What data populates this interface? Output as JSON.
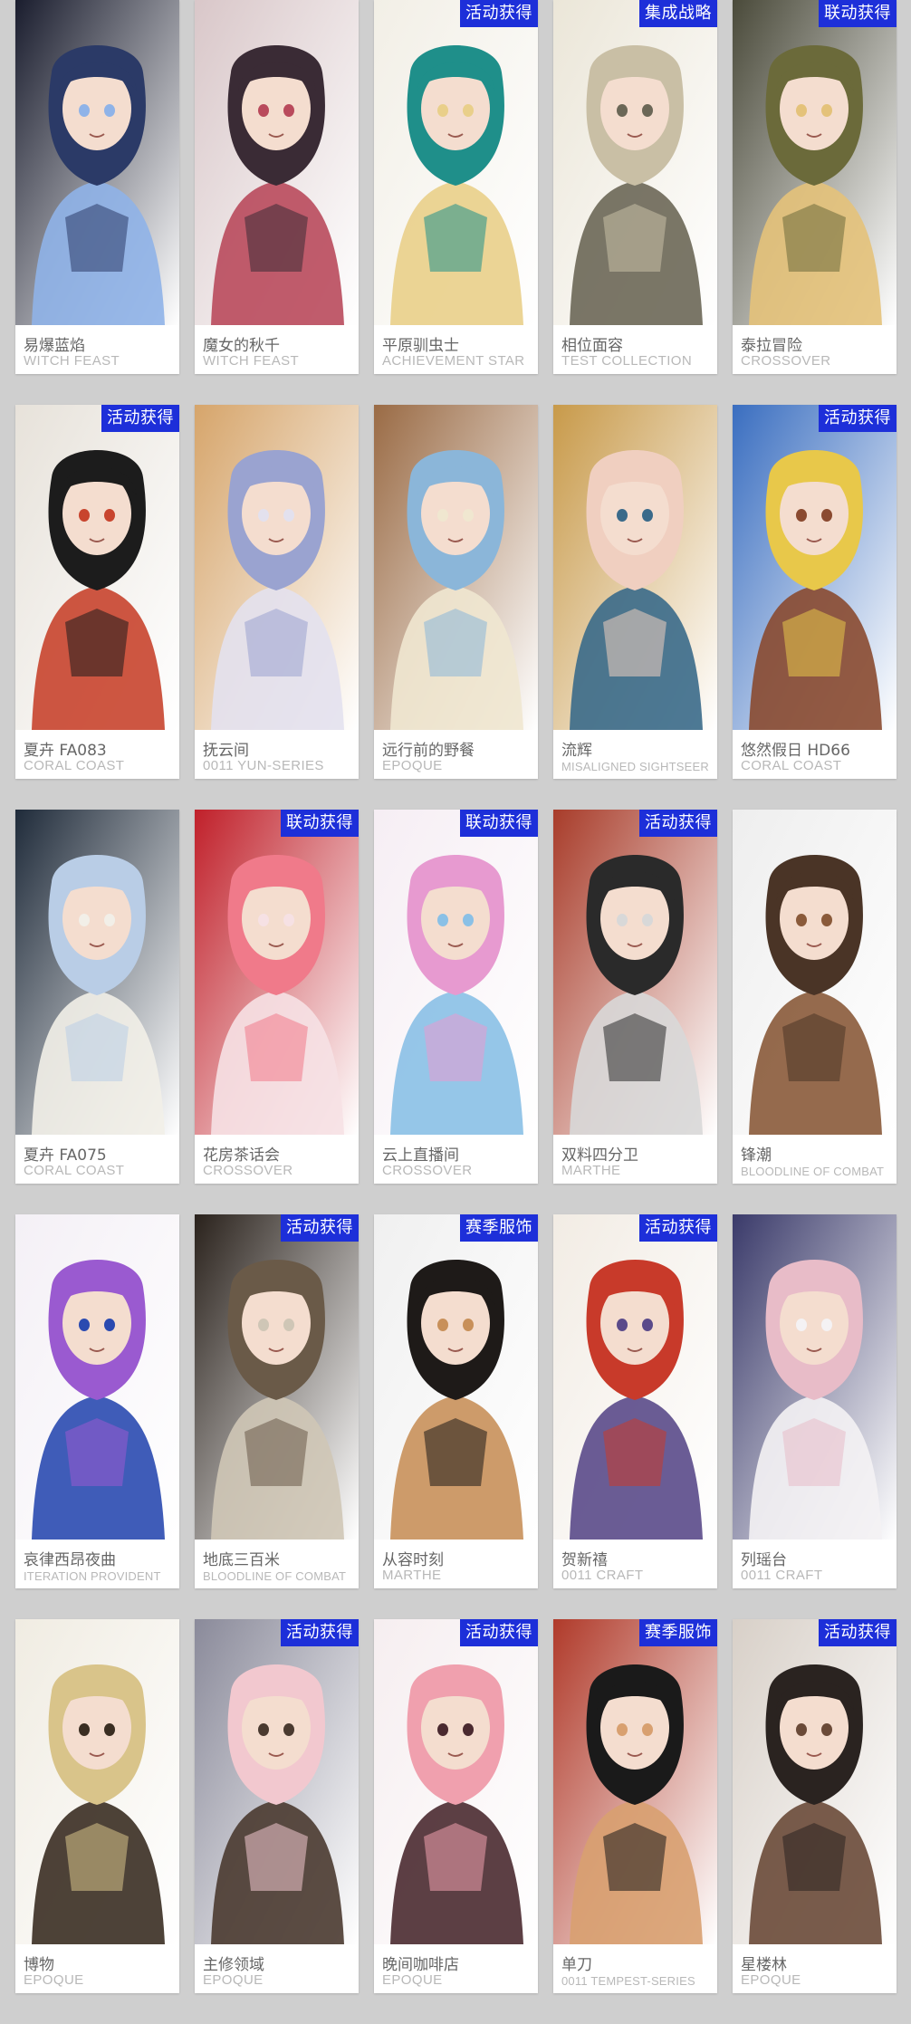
{
  "cards": [
    {
      "name": "易爆蓝焰",
      "series": "WITCH FEAST",
      "badge": "",
      "palette": [
        "#2b3a67",
        "#8fb3e8",
        "#1a1d2e"
      ]
    },
    {
      "name": "魔女的秋千",
      "series": "WITCH FEAST",
      "badge": "",
      "palette": [
        "#3a2b35",
        "#b94a5c",
        "#d9c7c9"
      ]
    },
    {
      "name": "平原驯虫士",
      "series": "ACHIEVEMENT STAR",
      "badge": "活动获得",
      "palette": [
        "#1f8f8a",
        "#e9cf8a",
        "#f2efe6"
      ]
    },
    {
      "name": "相位面容",
      "series": "TEST COLLECTION",
      "badge": "集成战略",
      "palette": [
        "#c9bfa5",
        "#6b6757",
        "#ebe6d8"
      ]
    },
    {
      "name": "泰拉冒险",
      "series": "CROSSOVER",
      "badge": "联动获得",
      "palette": [
        "#6b6a3a",
        "#e4c27a",
        "#4a4a3a"
      ]
    },
    {
      "name": "夏卉 FA083",
      "series": "CORAL COAST",
      "badge": "活动获得",
      "palette": [
        "#1c1c1c",
        "#c8442e",
        "#e7e2da"
      ]
    },
    {
      "name": "抚云间",
      "series": "0011 YUN-SERIES",
      "badge": "",
      "palette": [
        "#9aa3d0",
        "#e3e1ee",
        "#d6a56b"
      ]
    },
    {
      "name": "远行前的野餐",
      "series": "EPOQUE",
      "badge": "",
      "palette": [
        "#8bb6d9",
        "#f0e7d0",
        "#9a6b45"
      ]
    },
    {
      "name": "流辉",
      "series": "MISALIGNED SIGHTSEER",
      "badge": "",
      "palette": [
        "#f0cfc0",
        "#3a6a8a",
        "#c89a4a"
      ]
    },
    {
      "name": "悠然假日 HD66",
      "series": "CORAL COAST",
      "badge": "活动获得",
      "palette": [
        "#e8c84a",
        "#8a4a30",
        "#3a6ec0"
      ]
    },
    {
      "name": "夏卉 FA075",
      "series": "CORAL COAST",
      "badge": "",
      "palette": [
        "#b9cde6",
        "#f2efe8",
        "#1f2b3a"
      ]
    },
    {
      "name": "花房茶话会",
      "series": "CROSSOVER",
      "badge": "联动获得",
      "palette": [
        "#f07a8a",
        "#f6e1e4",
        "#c0202a"
      ]
    },
    {
      "name": "云上直播间",
      "series": "CROSSOVER",
      "badge": "联动获得",
      "palette": [
        "#e79ad0",
        "#8ac0e6",
        "#f6eef4"
      ]
    },
    {
      "name": "双料四分卫",
      "series": "MARTHE",
      "badge": "活动获得",
      "palette": [
        "#2a2a2a",
        "#d8d8d8",
        "#a83c2a"
      ]
    },
    {
      "name": "锋潮",
      "series": "BLOODLINE OF COMBAT",
      "badge": "",
      "palette": [
        "#4a3426",
        "#8a5a3a",
        "#eeeeee"
      ]
    },
    {
      "name": "哀律西昂夜曲",
      "series": "ITERATION PROVIDENT",
      "badge": "",
      "palette": [
        "#9a5ad0",
        "#2a4ab0",
        "#f4f0f6"
      ]
    },
    {
      "name": "地底三百米",
      "series": "BLOODLINE OF COMBAT",
      "badge": "活动获得",
      "palette": [
        "#6a5a48",
        "#cfc6b6",
        "#2a221c"
      ]
    },
    {
      "name": "从容时刻",
      "series": "MARTHE",
      "badge": "赛季服饰",
      "palette": [
        "#1e1a18",
        "#c8905a",
        "#f0f0f0"
      ]
    },
    {
      "name": "贺新禧",
      "series": "0011 CRAFT",
      "badge": "活动获得",
      "palette": [
        "#c83a2a",
        "#5a4a8a",
        "#f2ece4"
      ]
    },
    {
      "name": "列瑶台",
      "series": "0011 CRAFT",
      "badge": "",
      "palette": [
        "#e8bcc8",
        "#f4f2f4",
        "#3a3a6a"
      ]
    },
    {
      "name": "博物",
      "series": "EPOQUE",
      "badge": "",
      "palette": [
        "#d9c48a",
        "#3a2e22",
        "#f0ece2"
      ]
    },
    {
      "name": "主修领域",
      "series": "EPOQUE",
      "badge": "活动获得",
      "palette": [
        "#f2c8cf",
        "#4a3a30",
        "#8a8a9a"
      ]
    },
    {
      "name": "晚间咖啡店",
      "series": "EPOQUE",
      "badge": "活动获得",
      "palette": [
        "#f0a0ae",
        "#4a2a30",
        "#f6eef0"
      ]
    },
    {
      "name": "单刀",
      "series": "0011 TEMPEST-SERIES",
      "badge": "赛季服饰",
      "palette": [
        "#1a1a1a",
        "#d8a070",
        "#b03a2a"
      ]
    },
    {
      "name": "星楼林",
      "series": "EPOQUE",
      "badge": "活动获得",
      "palette": [
        "#2a2320",
        "#6a4a38",
        "#d8d0c8"
      ]
    }
  ]
}
